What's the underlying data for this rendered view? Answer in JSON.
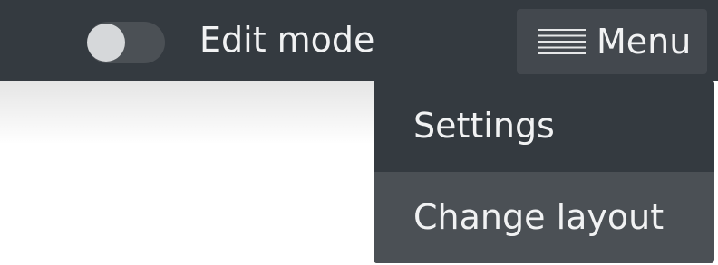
{
  "topbar": {
    "edit_toggle": {
      "label": "Edit mode",
      "state": "off"
    },
    "menu_button": {
      "label": "Menu",
      "icon": "hamburger-icon"
    }
  },
  "dropdown": {
    "items": [
      {
        "label": "Settings",
        "highlighted": true
      },
      {
        "label": "Change layout",
        "highlighted": false
      }
    ]
  },
  "colors": {
    "topbar_bg": "#343a40",
    "menu_button_bg": "#43484e",
    "dropdown_bg": "#4b5055",
    "dropdown_highlight_bg": "#343a40",
    "text": "#f1f2f3",
    "toggle_track": "#4b5055",
    "toggle_knob": "#d6d8da"
  }
}
